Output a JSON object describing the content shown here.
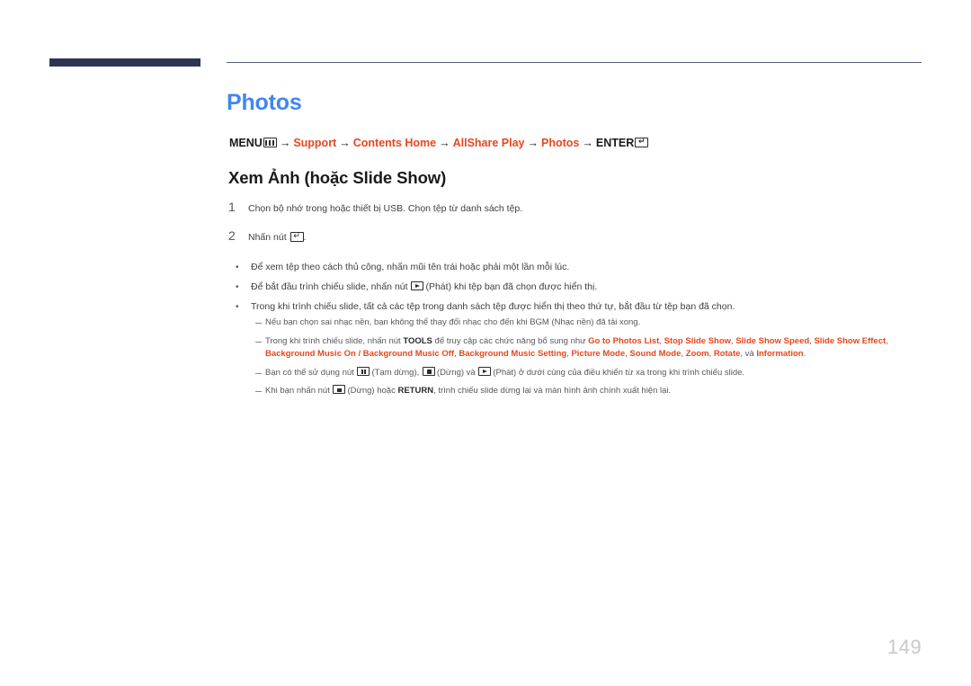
{
  "document": {
    "chapter_title": "Photos",
    "page_number": "149",
    "section_heading": "Xem Ảnh (hoặc Slide Show)"
  },
  "colors": {
    "accent_bar": "#2e3354",
    "chapter_title": "#4285f4",
    "link": "#e8471c",
    "body_text": "#3f3f41",
    "note_text": "#58585a",
    "page_number": "#c9c9cc"
  },
  "breadcrumb": {
    "items": [
      {
        "label": "MENU",
        "type": "plain",
        "icon": "menu-key-icon"
      },
      {
        "label": "Support",
        "type": "link"
      },
      {
        "label": "Contents Home",
        "type": "link"
      },
      {
        "label": "AllShare Play",
        "type": "link"
      },
      {
        "label": "Photos",
        "type": "link"
      },
      {
        "label": "ENTER",
        "type": "plain",
        "icon": "enter-key-icon"
      }
    ],
    "separator": "→"
  },
  "steps": [
    {
      "num": "1",
      "text": "Chọn bộ nhớ trong hoặc thiết bị USB. Chọn tệp từ danh sách tệp."
    },
    {
      "num": "2",
      "text_before": "Nhấn nút ",
      "icon": "enter-key-icon",
      "text_after": "."
    }
  ],
  "bullets": {
    "marker": "•",
    "items": [
      {
        "text": "Để xem tệp theo cách thủ công, nhấn mũi tên trái hoặc phải một lần mỗi lúc."
      },
      {
        "text_before": "Để bắt đầu trình chiếu slide, nhấn nút ",
        "icon": "play-key-icon",
        "text_after": "(Phát) khi tệp bạn đã chọn được hiển thị."
      },
      {
        "text": "Trong khi trình chiếu slide, tất cả các tệp trong danh sách tệp được hiển thị theo thứ tự, bắt đầu từ tệp bạn đã chọn."
      }
    ]
  },
  "notes": [
    {
      "id": "note-bgm",
      "text": "Nếu bạn chọn sai nhạc nền, bạn không thể thay đổi nhạc cho đến khi BGM (Nhạc nền) đã tải xong."
    },
    {
      "id": "note-tools",
      "text_1": "Trong khi trình chiếu slide, nhấn nút ",
      "bold_1": "TOOLS",
      "text_2": " để truy cập các chức năng bổ sung như ",
      "options": [
        "Go to Photos List",
        "Stop Slide Show",
        "Slide Show Speed",
        "Slide Show Effect",
        "Background Music On / Background Music Off",
        "Background Music Setting",
        "Picture Mode",
        "Sound Mode",
        "Zoom",
        "Rotate",
        "Information"
      ],
      "conjunction": "và ",
      "end": "."
    },
    {
      "id": "note-remote-keys",
      "text_1": "Bạn có thể sử dụng nút ",
      "icon_1": "pause-key-icon",
      "text_2": "(Tạm dừng), ",
      "icon_2": "stop-key-icon",
      "text_3": "(Dừng) và ",
      "icon_3": "play-key-icon",
      "text_4": "(Phát) ở dưới cùng của điều khiển từ xa trong khi trình chiếu slide."
    },
    {
      "id": "note-return",
      "text_1": "Khi bạn nhấn nút ",
      "icon_1": "stop-key-icon",
      "text_2": "(Dừng) hoặc ",
      "bold_1": "RETURN",
      "text_3": ", trình chiếu slide dừng lại và màn hình ảnh chính xuất hiện lại."
    }
  ]
}
